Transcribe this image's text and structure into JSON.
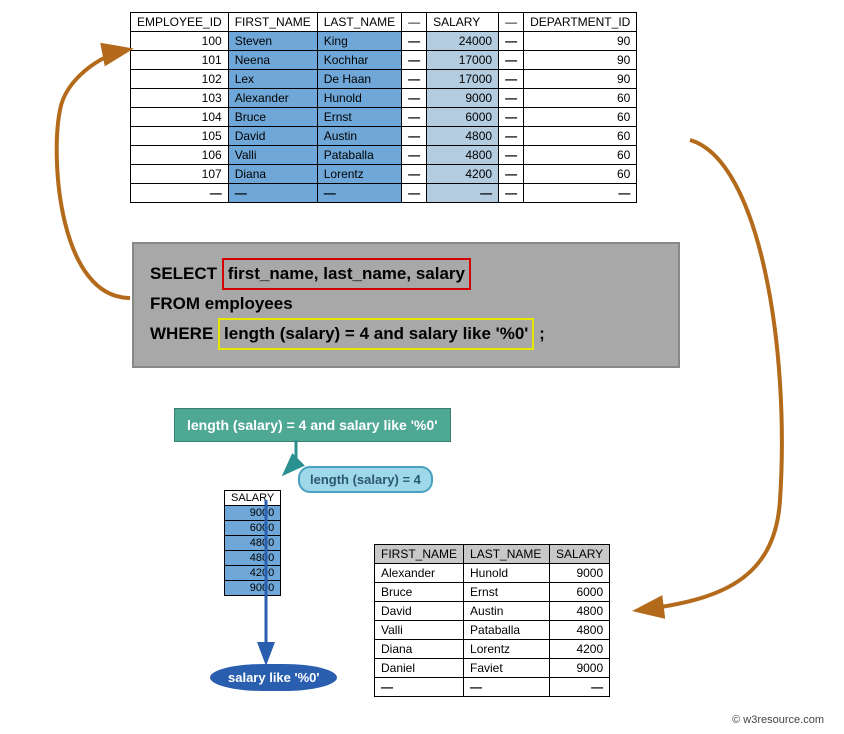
{
  "main": {
    "headers": [
      "EMPLOYEE_ID",
      "FIRST_NAME",
      "LAST_NAME",
      "—",
      "SALARY",
      "—",
      "DEPARTMENT_ID"
    ],
    "rows": [
      {
        "id": "100",
        "fn": "Steven",
        "ln": "King",
        "sal": "24000",
        "dep": "90"
      },
      {
        "id": "101",
        "fn": "Neena",
        "ln": "Kochhar",
        "sal": "17000",
        "dep": "90"
      },
      {
        "id": "102",
        "fn": "Lex",
        "ln": "De Haan",
        "sal": "17000",
        "dep": "90"
      },
      {
        "id": "103",
        "fn": "Alexander",
        "ln": "Hunold",
        "sal": "9000",
        "dep": "60"
      },
      {
        "id": "104",
        "fn": "Bruce",
        "ln": "Ernst",
        "sal": "6000",
        "dep": "60"
      },
      {
        "id": "105",
        "fn": "David",
        "ln": "Austin",
        "sal": "4800",
        "dep": "60"
      },
      {
        "id": "106",
        "fn": "Valli",
        "ln": "Pataballa",
        "sal": "4800",
        "dep": "60"
      },
      {
        "id": "107",
        "fn": "Diana",
        "ln": "Lorentz",
        "sal": "4200",
        "dep": "60"
      }
    ]
  },
  "sql": {
    "select": "SELECT",
    "cols": "first_name, last_name, salary",
    "from": "FROM employees",
    "where": "WHERE",
    "cond": "length (salary) = 4 and salary like '%0'",
    "semi": ";"
  },
  "bubbles": {
    "full": "length (salary) = 4 and salary like '%0'",
    "len": "length (salary) = 4",
    "like": "salary like '%0'"
  },
  "salcol": {
    "header": "SALARY",
    "vals": [
      "9000",
      "6000",
      "4800",
      "4800",
      "4200",
      "9000"
    ]
  },
  "result": {
    "headers": [
      "FIRST_NAME",
      "LAST_NAME",
      "SALARY"
    ],
    "rows": [
      {
        "fn": "Alexander",
        "ln": "Hunold",
        "sal": "9000"
      },
      {
        "fn": "Bruce",
        "ln": "Ernst",
        "sal": "6000"
      },
      {
        "fn": "David",
        "ln": "Austin",
        "sal": "4800"
      },
      {
        "fn": "Valli",
        "ln": "Pataballa",
        "sal": "4800"
      },
      {
        "fn": "Diana",
        "ln": "Lorentz",
        "sal": "4200"
      },
      {
        "fn": "Daniel",
        "ln": "Faviet",
        "sal": "9000"
      }
    ]
  },
  "copyright": "© w3resource.com",
  "dash": "—"
}
